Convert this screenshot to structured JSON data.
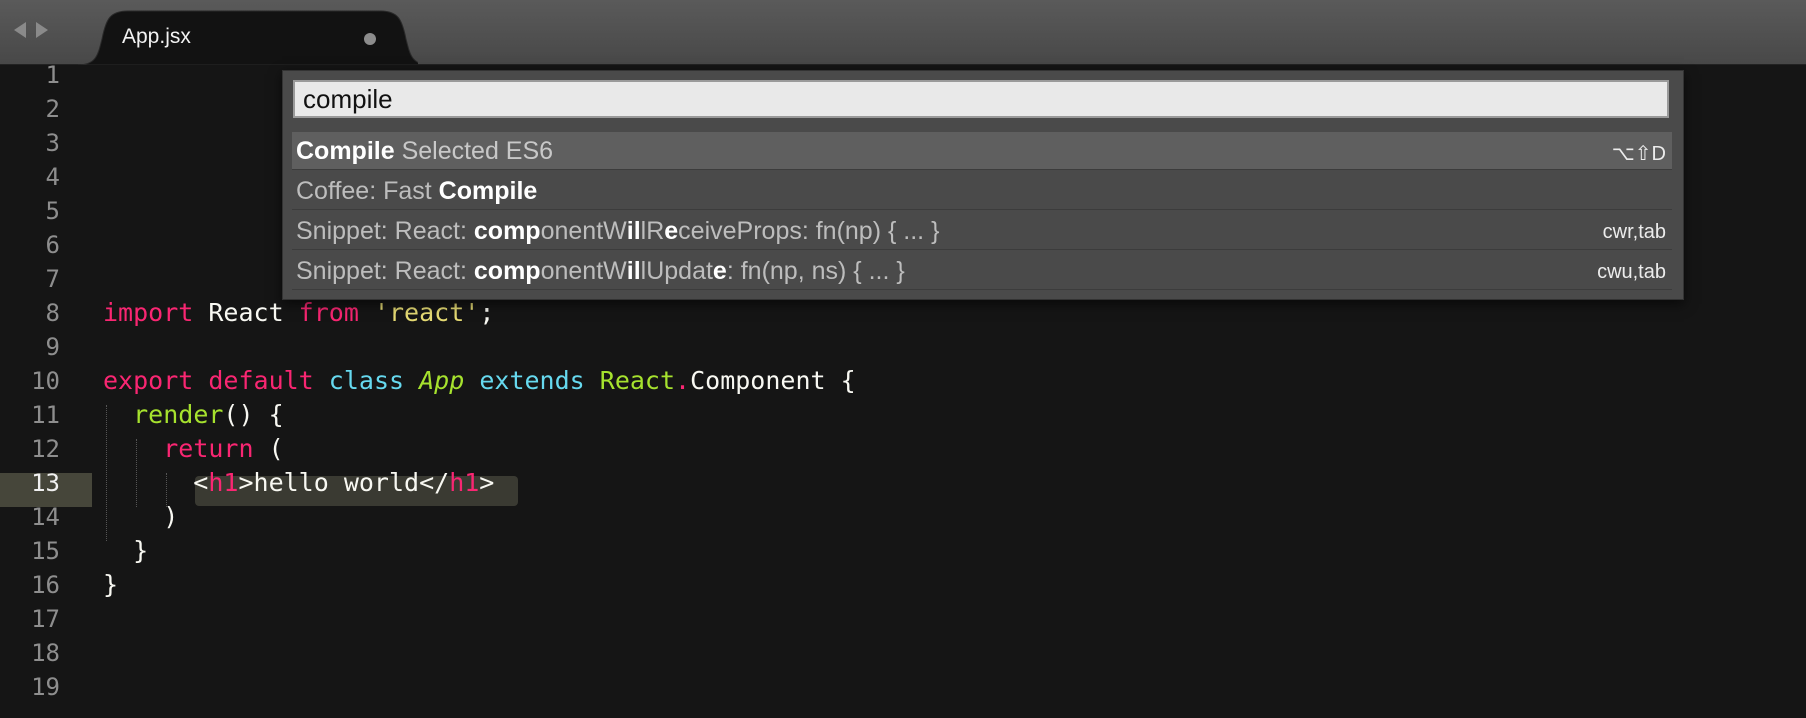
{
  "tabbar": {
    "tab_title": "App.jsx",
    "dirty_indicator": "modified-dot"
  },
  "palette": {
    "query": "compile",
    "items": [
      {
        "parts": [
          {
            "t": "Compile",
            "b": true
          },
          {
            "t": " Selected ES6",
            "b": false
          }
        ],
        "shortcut": "⌥⇧D"
      },
      {
        "parts": [
          {
            "t": "Coffee: Fast ",
            "b": false
          },
          {
            "t": "Compile",
            "b": true
          }
        ],
        "shortcut": ""
      },
      {
        "parts": [
          {
            "t": "Snippet: React: ",
            "b": false
          },
          {
            "t": "comp",
            "b": true
          },
          {
            "t": "onentW",
            "b": false
          },
          {
            "t": "il",
            "b": true
          },
          {
            "t": "lR",
            "b": false
          },
          {
            "t": "e",
            "b": true
          },
          {
            "t": "ceiveProps: fn(np) { ... }",
            "b": false
          }
        ],
        "shortcut": "cwr,tab"
      },
      {
        "parts": [
          {
            "t": "Snippet: React: ",
            "b": false
          },
          {
            "t": "comp",
            "b": true
          },
          {
            "t": "onentW",
            "b": false
          },
          {
            "t": "il",
            "b": true
          },
          {
            "t": "lUpdat",
            "b": false
          },
          {
            "t": "e",
            "b": true
          },
          {
            "t": ": fn(np, ns) { ... }",
            "b": false
          }
        ],
        "shortcut": "cwu,tab"
      }
    ]
  },
  "editor": {
    "current_line": 13,
    "line_numbers": [
      "1",
      "2",
      "3",
      "4",
      "5",
      "6",
      "7",
      "8",
      "9",
      "10",
      "11",
      "12",
      "13",
      "14",
      "15",
      "16",
      "17",
      "18",
      "19"
    ],
    "lines": {
      "l8": [
        {
          "t": "import",
          "c": "kw"
        },
        {
          "t": " React ",
          "c": ""
        },
        {
          "t": "from",
          "c": "kw"
        },
        {
          "t": " ",
          "c": ""
        },
        {
          "t": "'react'",
          "c": "st"
        },
        {
          "t": ";",
          "c": ""
        }
      ],
      "l10": [
        {
          "t": "export",
          "c": "kw"
        },
        {
          "t": " ",
          "c": ""
        },
        {
          "t": "default",
          "c": "kw"
        },
        {
          "t": " ",
          "c": ""
        },
        {
          "t": "class",
          "c": "cl"
        },
        {
          "t": " ",
          "c": ""
        },
        {
          "t": "App",
          "c": "it"
        },
        {
          "t": " ",
          "c": ""
        },
        {
          "t": "extends",
          "c": "cl"
        },
        {
          "t": " ",
          "c": ""
        },
        {
          "t": "React",
          "c": "fn"
        },
        {
          "t": ".",
          "c": "kw"
        },
        {
          "t": "Component {",
          "c": ""
        }
      ],
      "l11": [
        {
          "t": "  ",
          "c": ""
        },
        {
          "t": "render",
          "c": "fn"
        },
        {
          "t": "() {",
          "c": ""
        }
      ],
      "l12": [
        {
          "t": "    ",
          "c": ""
        },
        {
          "t": "return",
          "c": "kw"
        },
        {
          "t": " (",
          "c": ""
        }
      ],
      "l13": [
        {
          "t": "      <",
          "c": ""
        },
        {
          "t": "h1",
          "c": "tag"
        },
        {
          "t": ">hello world</",
          "c": ""
        },
        {
          "t": "h1",
          "c": "tag"
        },
        {
          "t": ">",
          "c": ""
        }
      ],
      "l14": [
        {
          "t": "    )",
          "c": ""
        }
      ],
      "l15": [
        {
          "t": "  }",
          "c": ""
        }
      ],
      "l16": [
        {
          "t": "}",
          "c": ""
        }
      ]
    }
  }
}
